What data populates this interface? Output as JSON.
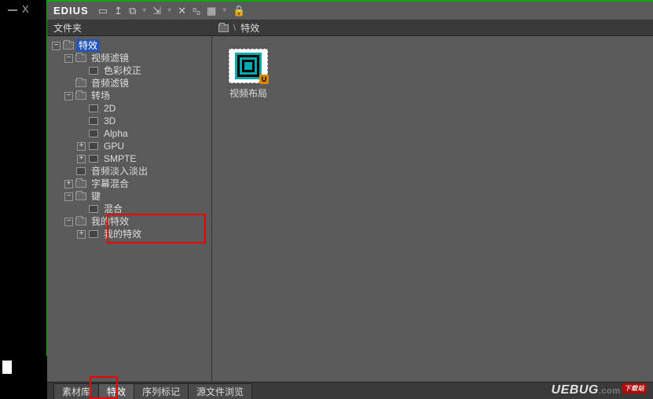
{
  "app": {
    "title": "EDIUS"
  },
  "panels": {
    "folder_header": "文件夹",
    "content_header": "特效"
  },
  "tree": {
    "root": "特效",
    "video_filter": "视频滤镜",
    "color_correction": "色彩校正",
    "audio_filter": "音频滤镜",
    "transition": "转场",
    "t_2d": "2D",
    "t_3d": "3D",
    "t_alpha": "Alpha",
    "t_gpu": "GPU",
    "t_smpte": "SMPTE",
    "audio_fade": "音频淡入淡出",
    "title_mix": "字幕混合",
    "keys": "键",
    "blend": "混合",
    "my_effects": "我的特效",
    "my_effects_sub": "我的特效"
  },
  "content": {
    "item1_label": "视频布局",
    "badge": "U"
  },
  "tabs": {
    "t1": "素材库",
    "t2": "特效",
    "t3": "序列标记",
    "t4": "源文件浏览"
  },
  "watermark": {
    "brand": "UEBUG",
    "suffix": ".com",
    "tag": "下载站"
  }
}
